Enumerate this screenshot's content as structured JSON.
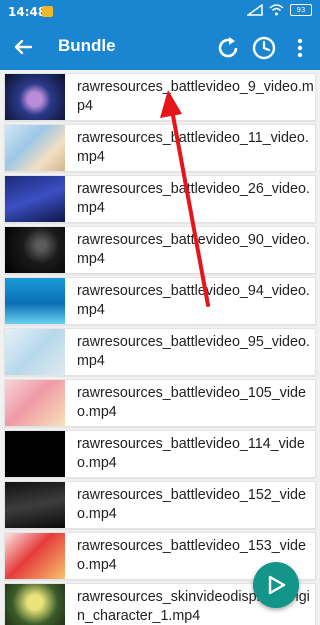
{
  "status_bar": {
    "time": "14:48",
    "battery": "93"
  },
  "app_bar": {
    "title": "Bundle",
    "back_icon": "arrow-left-icon",
    "refresh_icon": "refresh-icon",
    "history_icon": "clock-icon",
    "menu_icon": "more-vert-icon"
  },
  "files": [
    {
      "name": "rawresources_battlevideo_9_video.mp4"
    },
    {
      "name": "rawresources_battlevideo_11_video.mp4"
    },
    {
      "name": "rawresources_battlevideo_26_video.mp4"
    },
    {
      "name": "rawresources_battlevideo_90_video.mp4"
    },
    {
      "name": "rawresources_battlevideo_94_video.mp4"
    },
    {
      "name": "rawresources_battlevideo_95_video.mp4"
    },
    {
      "name": "rawresources_battlevideo_105_video.mp4"
    },
    {
      "name": "rawresources_battlevideo_114_video.mp4"
    },
    {
      "name": "rawresources_battlevideo_152_video.mp4"
    },
    {
      "name": "rawresources_battlevideo_153_video.mp4"
    },
    {
      "name": "rawresources_skinvideodisplay_origin_character_1.mp4"
    }
  ],
  "fab": {
    "icon": "play-icon"
  },
  "colors": {
    "app_bar": "#1a85d0",
    "fab": "#14958a",
    "annotation_arrow": "#e8141b"
  }
}
